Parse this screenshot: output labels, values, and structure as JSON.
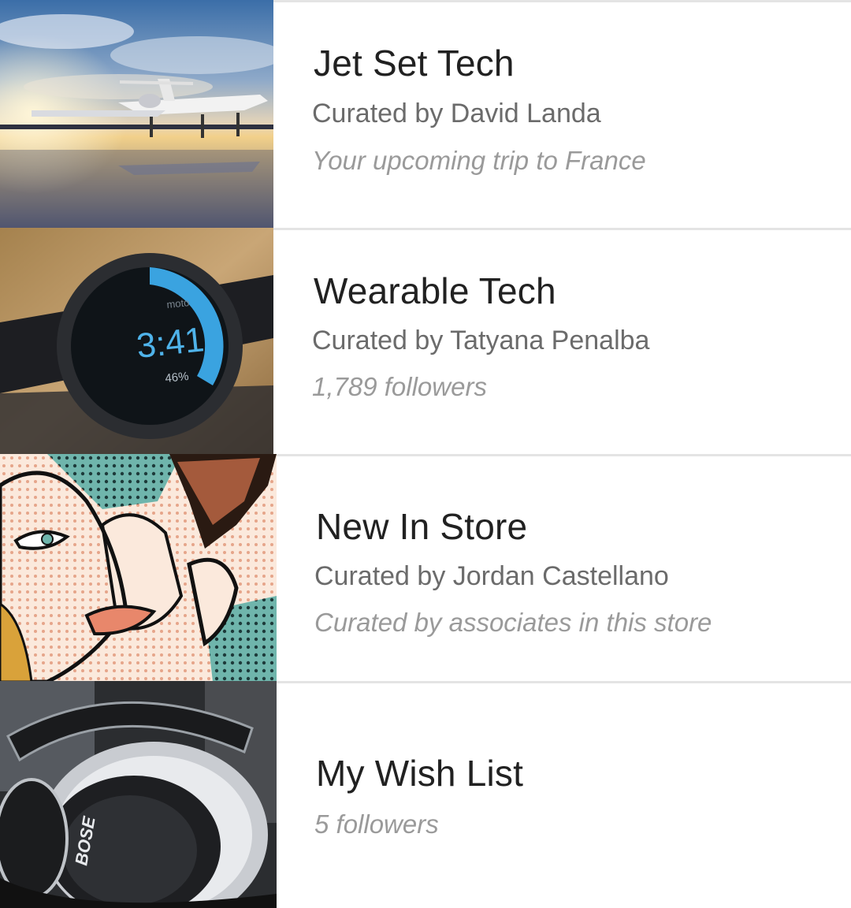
{
  "collections": [
    {
      "title": "Jet Set Tech",
      "curator": "Curated by David Landa",
      "meta": "Your upcoming trip to France",
      "image": "private-jet-photo"
    },
    {
      "title": "Wearable Tech",
      "curator": "Curated by Tatyana Penalba",
      "meta": "1,789 followers",
      "image": "smartwatch-photo",
      "image_watch": {
        "brand": "moto",
        "time": "3:41",
        "battery": "46%"
      }
    },
    {
      "title": "New In Store",
      "curator": "Curated by Jordan Castellano",
      "meta": "Curated by associates in this store",
      "image": "pop-art-whisper-illustration"
    },
    {
      "title": "My Wish List",
      "meta": "5 followers",
      "image": "headphones-photo",
      "image_brand": "BOSE"
    }
  ],
  "colors": {
    "title": "#212121",
    "curator": "#6b6b6b",
    "meta": "#9a9a9a",
    "divider": "#e4e4e4",
    "watch_accent": "#3aa3e0"
  }
}
